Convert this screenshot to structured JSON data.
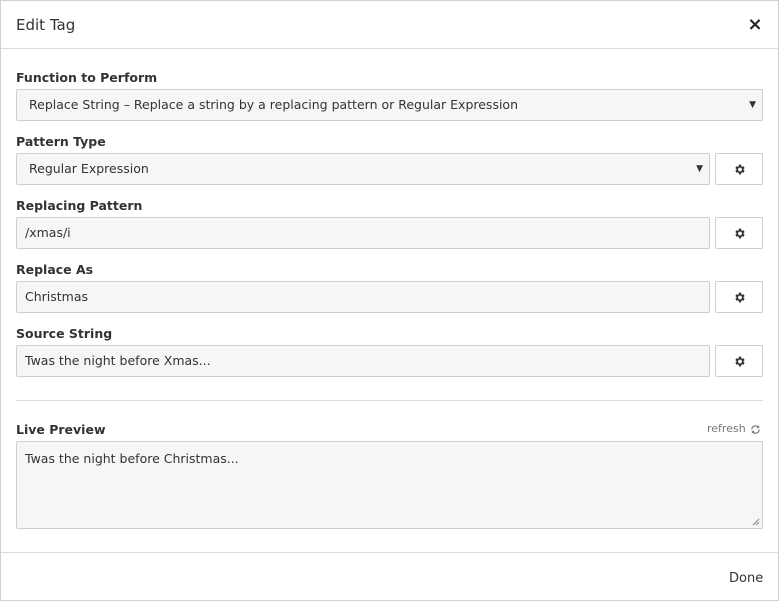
{
  "dialog": {
    "title": "Edit Tag",
    "close_symbol": "×"
  },
  "function": {
    "label": "Function to Perform",
    "value": "Replace String – Replace a string by a replacing pattern or Regular Expression"
  },
  "pattern_type": {
    "label": "Pattern Type",
    "value": "Regular Expression"
  },
  "replacing_pattern": {
    "label": "Replacing Pattern",
    "value": "/xmas/i"
  },
  "replace_as": {
    "label": "Replace As",
    "value": "Christmas"
  },
  "source_string": {
    "label": "Source String",
    "value": "Twas the night before Xmas..."
  },
  "preview": {
    "label": "Live Preview",
    "refresh_label": "refresh",
    "value": "Twas the night before Christmas..."
  },
  "footer": {
    "done_label": "Done"
  },
  "icons": {
    "close": "close-icon",
    "gear": "gear-icon",
    "refresh": "refresh-icon",
    "caret": "caret-down-icon"
  }
}
